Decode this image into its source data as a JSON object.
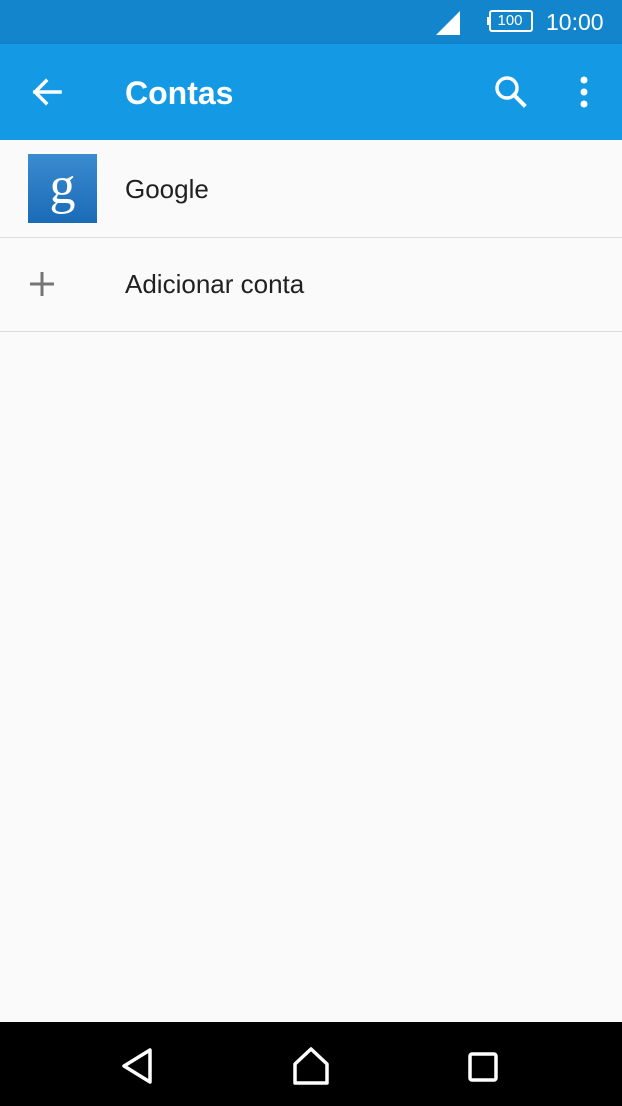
{
  "status_bar": {
    "time": "10:00",
    "battery_level": "100",
    "icons": [
      "signal-icon",
      "battery-icon"
    ]
  },
  "app_bar": {
    "title": "Contas",
    "icons": [
      "back-arrow-icon",
      "search-icon",
      "more-vert-icon"
    ]
  },
  "accounts": {
    "items": [
      {
        "label": "Google",
        "icon": "google-icon"
      },
      {
        "label": "Adicionar conta",
        "icon": "plus-icon"
      }
    ]
  },
  "nav_bar": {
    "icons": [
      "nav-back-icon",
      "nav-home-icon",
      "nav-recents-icon"
    ]
  },
  "colors": {
    "status_bar": "#1285cc",
    "app_bar": "#149ae5",
    "background": "#fafafa",
    "text": "#212121",
    "nav_bar": "#000000"
  }
}
